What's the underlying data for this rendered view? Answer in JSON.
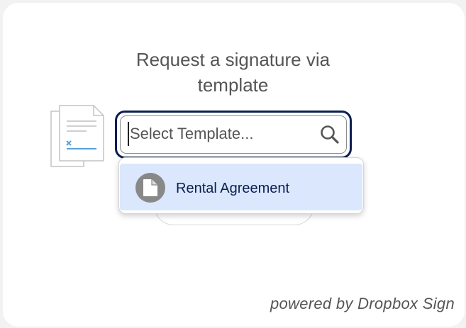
{
  "header": {
    "title_line1": "Request a signature via",
    "title_line2": "template"
  },
  "template_select": {
    "placeholder": "Select Template...",
    "value": "",
    "accent_color": "#0b1e52"
  },
  "dropdown": {
    "options": [
      {
        "label": "Rental Agreement",
        "icon": "document-icon",
        "highlighted": true,
        "highlight_color": "#dbe7fc"
      }
    ]
  },
  "footer": {
    "text": "powered by Dropbox Sign"
  }
}
